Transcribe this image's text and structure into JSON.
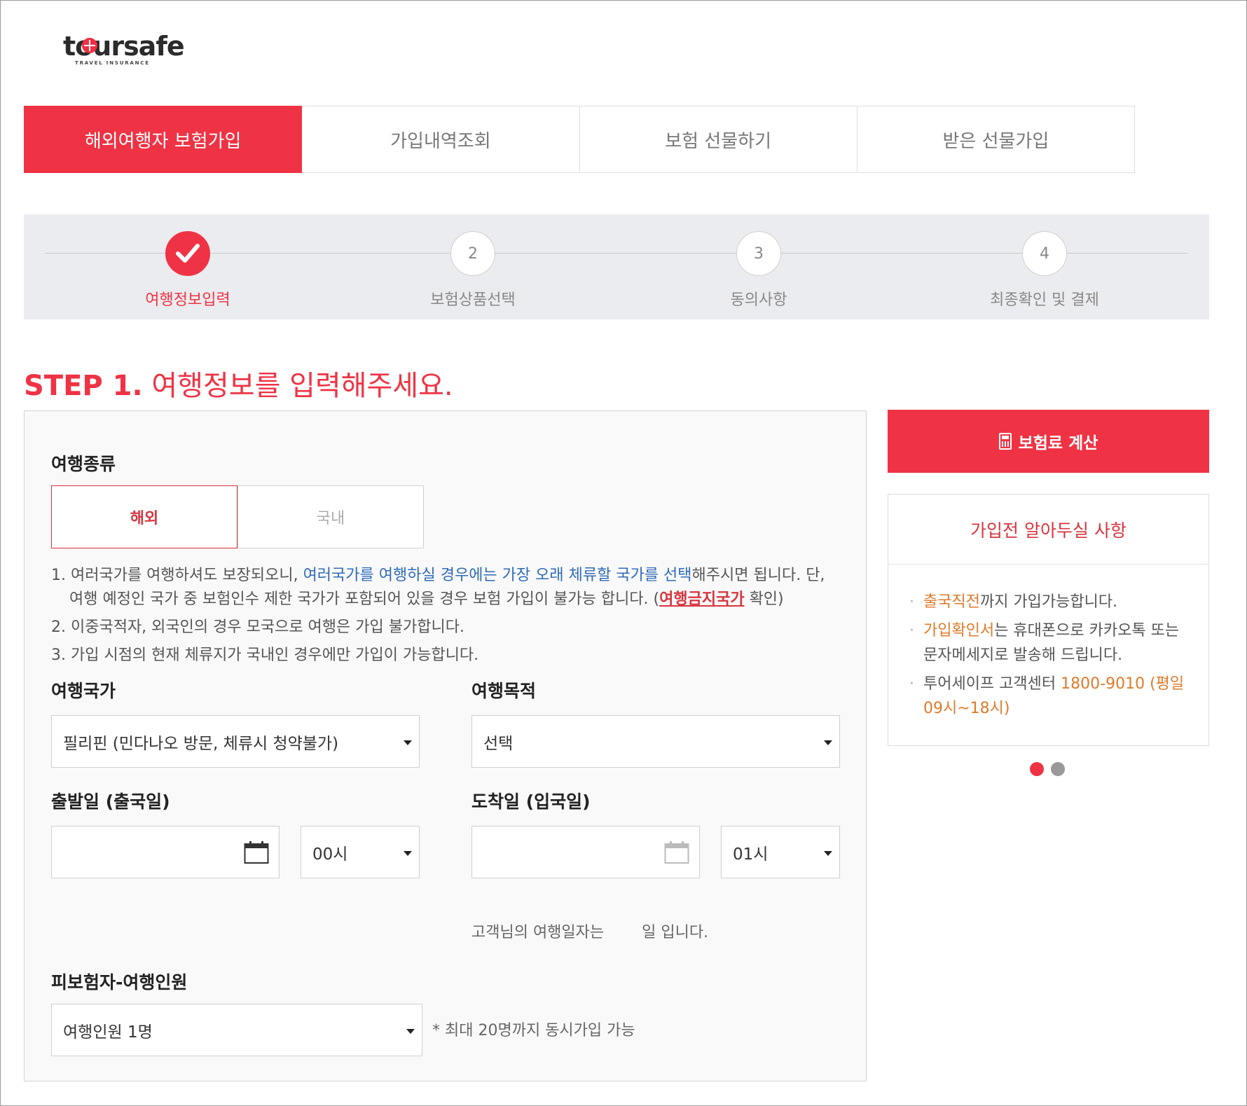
{
  "brand": {
    "name": "toursafe",
    "tagline": "TRAVEL INSURANCE"
  },
  "tabs": [
    {
      "label": "해외여행자 보험가입",
      "active": true
    },
    {
      "label": "가입내역조회",
      "active": false
    },
    {
      "label": "보험 선물하기",
      "active": false
    },
    {
      "label": "받은 선물가입",
      "active": false
    }
  ],
  "steps": [
    {
      "number": "1",
      "label": "여행정보입력",
      "state": "done"
    },
    {
      "number": "2",
      "label": "보험상품선택",
      "state": "pending"
    },
    {
      "number": "3",
      "label": "동의사항",
      "state": "pending"
    },
    {
      "number": "4",
      "label": "최종확인 및 결제",
      "state": "pending"
    }
  ],
  "heading": {
    "step": "STEP 1.",
    "text": "여행정보를 입력해주세요."
  },
  "form": {
    "trip_type": {
      "label": "여행종류",
      "options": [
        "해외",
        "국내"
      ],
      "selected": "해외"
    },
    "notes": {
      "n1_a": "1. 여러국가를 여행하셔도 보장되오니, ",
      "n1_b": "여러국가를 여행하실 경우에는 가장 오래 체류할 국가를 선택",
      "n1_c": "해주시면 됩니다. 단, 여행 예정인 국가 중 보험인수 제한 국가가 포함되어 있을 경우 보험 가입이 불가능 합니다. (",
      "n1_link": "여행금지국가",
      "n1_d": " 확인)",
      "n2": "2. 이중국적자, 외국인의 경우 모국으로 여행은 가입 불가합니다.",
      "n3": "3. 가입 시점의 현재 체류지가 국내인 경우에만 가입이 가능합니다."
    },
    "country": {
      "label": "여행국가",
      "value": "필리핀 (민다나오 방문, 체류시 청약불가)"
    },
    "purpose": {
      "label": "여행목적",
      "value": "선택"
    },
    "departure": {
      "label": "출발일 (출국일)",
      "date": "",
      "hour": "00시"
    },
    "arrival": {
      "label": "도착일 (입국일)",
      "date": "",
      "hour": "01시"
    },
    "duration_hint": {
      "prefix": "고객님의 여행일자는",
      "suffix": "일 입니다."
    },
    "insured": {
      "label": "피보험자-여행인원",
      "value": "여행인원 1명",
      "hint": "* 최대 20명까지 동시가입 가능"
    }
  },
  "calc_button": {
    "label": "보험료 계산",
    "icon": "calculator-icon"
  },
  "info_box": {
    "title": "가입전 알아두실 사항",
    "i1_hl": "출국직전",
    "i1_rest": "까지 가입가능합니다.",
    "i2_hl": "가입확인서",
    "i2_rest": "는 휴대폰으로 카카오톡 또는 문자메세지로 발송해 드립니다.",
    "i3_rest": "투어세이프 고객센터 ",
    "i3_hl": "1800-9010 (평일 09시~18시)"
  },
  "carousel": {
    "count": 2,
    "active_index": 0
  },
  "colors": {
    "accent": "#ef3344",
    "link_blue": "#2f6bb8",
    "highlight_orange": "#e07a2a"
  }
}
